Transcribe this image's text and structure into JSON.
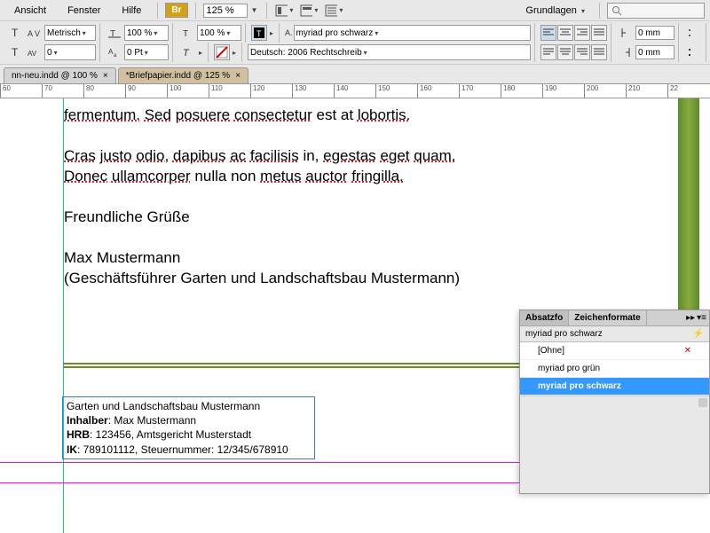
{
  "menu": {
    "ansicht": "Ansicht",
    "fenster": "Fenster",
    "hilfe": "Hilfe",
    "br": "Br",
    "zoom": "125 %",
    "workspace": "Grundlagen"
  },
  "toolbar": {
    "metric": "Metrisch",
    "scale_h": "100 %",
    "scale_v": "100 %",
    "font_style": "myriad pro schwarz",
    "kerning": "0",
    "leading": "0 Pt",
    "lang": "Deutsch: 2006 Rechtschreib",
    "indent_left": "0 mm",
    "indent_right": "0 mm"
  },
  "tabs": {
    "t1": "nn-neu.indd @ 100 %",
    "t2": "*Briefpapier.indd @ 125 %"
  },
  "ruler": {
    "marks": [
      "60",
      "70",
      "80",
      "90",
      "100",
      "110",
      "120",
      "130",
      "140",
      "150",
      "160",
      "170",
      "180",
      "190",
      "200",
      "210",
      "22"
    ]
  },
  "doc": {
    "line1a": "fermentum.",
    "line1b": "Sed",
    "line1c": "posuere",
    "line1d": "consectetur",
    "line1e": "est at",
    "line1f": "lobortis.",
    "line2a": "Cras",
    "line2b": "justo",
    "line2c": "odio,",
    "line2d": "dapibus",
    "line2e": "ac",
    "line2f": "facilisis",
    "line2g": "in,",
    "line2h": "egestas",
    "line2i": "eget",
    "line2j": "quam.",
    "line3a": "Donec",
    "line3b": "ullamcorper",
    "line3c": "nulla non",
    "line3d": "metus",
    "line3e": "auctor",
    "line3f": "fringilla.",
    "greet": "Freundliche Grüße",
    "name": "Max Mustermann",
    "role": "(Geschäftsführer Garten und Landschaftsbau Mustermann)"
  },
  "footer": {
    "l1": "Garten und Landschaftsbau Mustermann",
    "l2a": "Inhalber",
    "l2b": ": Max Mustermann",
    "l3a": "HRB",
    "l3b": ": 123456, Amtsgericht Musterstadt",
    "l4a": "IK",
    "l4b": ": 789101112, Steuernummer: 12/345/678910"
  },
  "panel": {
    "tab1": "Absatzfo",
    "tab2": "Zeichenformate",
    "current": "myriad pro schwarz",
    "items": [
      "[Ohne]",
      "myriad pro grün",
      "myriad pro schwarz"
    ]
  }
}
